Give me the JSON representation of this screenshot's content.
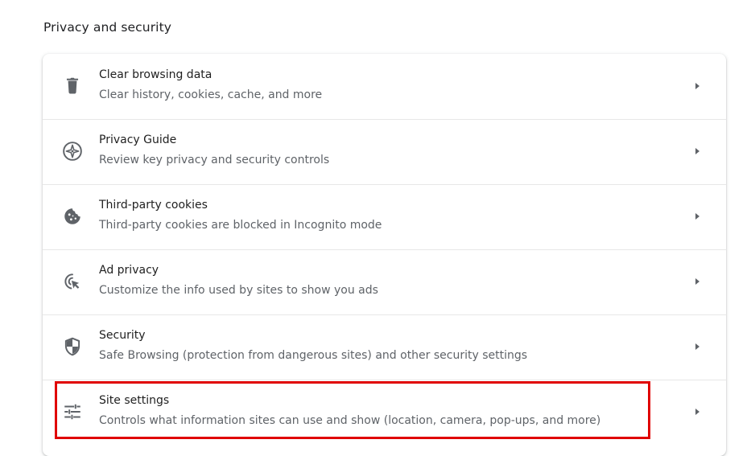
{
  "section": {
    "title": "Privacy and security"
  },
  "items": [
    {
      "title": "Clear browsing data",
      "subtitle": "Clear history, cookies, cache, and more",
      "icon": "trash-icon"
    },
    {
      "title": "Privacy Guide",
      "subtitle": "Review key privacy and security controls",
      "icon": "compass-icon"
    },
    {
      "title": "Third-party cookies",
      "subtitle": "Third-party cookies are blocked in Incognito mode",
      "icon": "cookie-icon"
    },
    {
      "title": "Ad privacy",
      "subtitle": "Customize the info used by sites to show you ads",
      "icon": "ad-privacy-icon"
    },
    {
      "title": "Security",
      "subtitle": "Safe Browsing (protection from dangerous sites) and other security settings",
      "icon": "shield-icon"
    },
    {
      "title": "Site settings",
      "subtitle": "Controls what information sites can use and show (location, camera, pop-ups, and more)",
      "icon": "tune-icon"
    }
  ],
  "colors": {
    "icon": "#5f6368",
    "highlight": "#e00000",
    "subtitle": "#5f6368"
  }
}
